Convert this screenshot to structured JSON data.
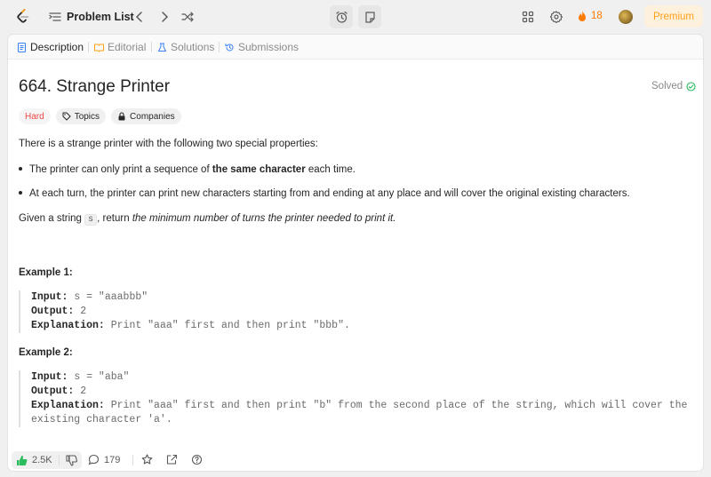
{
  "topbar": {
    "problem_list_label": "Problem List",
    "streak_count": "18",
    "premium_label": "Premium"
  },
  "tabs": [
    {
      "label": "Description",
      "icon": "description-icon",
      "active": true
    },
    {
      "label": "Editorial",
      "icon": "editorial-icon",
      "active": false
    },
    {
      "label": "Solutions",
      "icon": "solutions-icon",
      "active": false
    },
    {
      "label": "Submissions",
      "icon": "submissions-icon",
      "active": false
    }
  ],
  "problem": {
    "title": "664. Strange Printer",
    "status": "Solved",
    "difficulty": "Hard",
    "topics_label": "Topics",
    "companies_label": "Companies",
    "intro": "There is a strange printer with the following two special properties:",
    "bullet1_pre": "The printer can only print a sequence of ",
    "bullet1_bold": "the same character",
    "bullet1_post": " each time.",
    "bullet2": "At each turn, the printer can print new characters starting from and ending at any place and will cover the original existing characters.",
    "given_pre": "Given a string ",
    "given_code": "s",
    "given_mid": ", return ",
    "given_italic": "the minimum number of turns the printer needed to print it.",
    "examples": [
      {
        "title": "Example 1:",
        "input_label": "Input:",
        "input": "s = \"aaabbb\"",
        "output_label": "Output:",
        "output": "2",
        "explanation_label": "Explanation:",
        "explanation_line1": "Print \"aaa\" first and then print \"bbb\".",
        "explanation_line2": ""
      },
      {
        "title": "Example 2:",
        "input_label": "Input:",
        "input": "s = \"aba\"",
        "output_label": "Output:",
        "output": "2",
        "explanation_label": "Explanation:",
        "explanation_line1": "Print \"aaa\" first and then print \"b\" from the second place of the string, which will cover the",
        "explanation_line2": "existing character 'a'."
      }
    ]
  },
  "footer": {
    "likes": "2.5K",
    "comments": "179"
  },
  "colors": {
    "accent": "#ffa116",
    "hard": "#ef4743",
    "solved": "#2cbb5d",
    "like_green": "#2cbb5d",
    "streak": "#ff7a00"
  }
}
